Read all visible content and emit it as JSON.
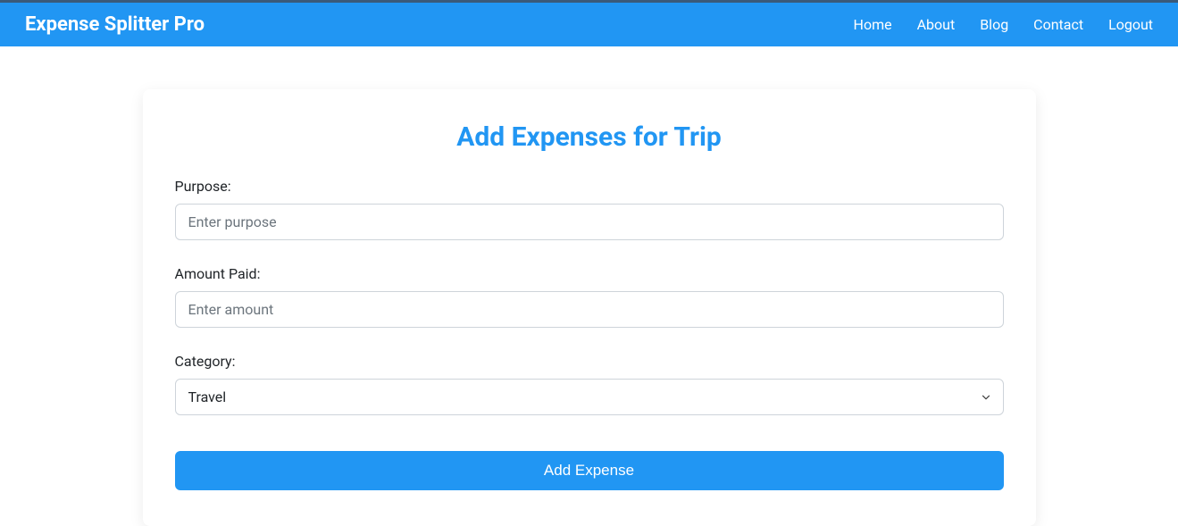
{
  "navbar": {
    "brand": "Expense Splitter Pro",
    "links": {
      "home": "Home",
      "about": "About",
      "blog": "Blog",
      "contact": "Contact",
      "logout": "Logout"
    }
  },
  "form": {
    "title": "Add Expenses for Trip",
    "purpose": {
      "label": "Purpose:",
      "placeholder": "Enter purpose",
      "value": ""
    },
    "amount": {
      "label": "Amount Paid:",
      "placeholder": "Enter amount",
      "value": ""
    },
    "category": {
      "label": "Category:",
      "selected": "Travel"
    },
    "submit_label": "Add Expense"
  }
}
